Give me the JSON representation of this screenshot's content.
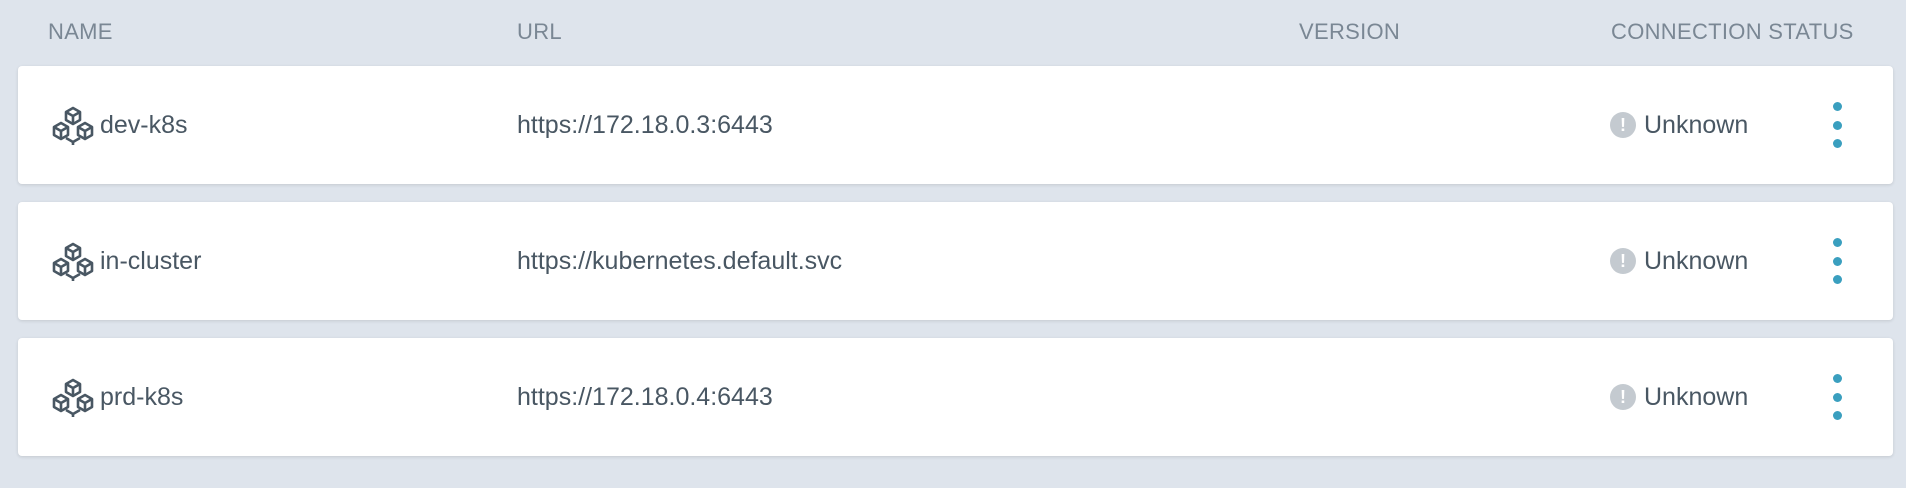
{
  "columns": {
    "name": "NAME",
    "url": "URL",
    "version": "VERSION",
    "connection_status": "CONNECTION STATUS"
  },
  "clusters": [
    {
      "name": "dev-k8s",
      "url": "https://172.18.0.3:6443",
      "version": "",
      "status": "Unknown",
      "status_icon": "exclamation-circle-icon",
      "icon": "cluster-icon"
    },
    {
      "name": "in-cluster",
      "url": "https://kubernetes.default.svc",
      "version": "",
      "status": "Unknown",
      "status_icon": "exclamation-circle-icon",
      "icon": "cluster-icon"
    },
    {
      "name": "prd-k8s",
      "url": "https://172.18.0.4:6443",
      "version": "",
      "status": "Unknown",
      "status_icon": "exclamation-circle-icon",
      "icon": "cluster-icon"
    }
  ],
  "colors": {
    "background": "#dee4ec",
    "card": "#ffffff",
    "text": "#495763",
    "header_text": "#7a8794",
    "status_icon": "#c4cad0",
    "menu_dots": "#3a9fbf"
  }
}
